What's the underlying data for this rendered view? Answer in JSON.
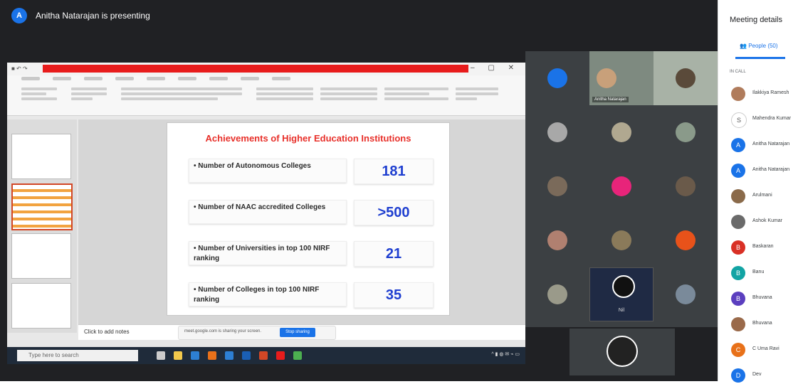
{
  "presenter": {
    "avatar_letter": "A",
    "text": "Anitha Natarajan is presenting"
  },
  "slide": {
    "title": "Achievements of Higher Education Institutions",
    "rows": [
      {
        "label": "• Number of Autonomous Colleges",
        "value": "181"
      },
      {
        "label": "• Number of NAAC accredited Colleges",
        "value": ">500"
      },
      {
        "label": "• Number of Universities in top 100 NIRF ranking",
        "value": "21"
      },
      {
        "label": "• Number of Colleges in top 100 NIRF ranking",
        "value": "35"
      }
    ]
  },
  "notes_placeholder": "Click to add notes",
  "sharing_bar": {
    "message": "meet.google.com is sharing your screen.",
    "stop_label": "Stop sharing"
  },
  "taskbar": {
    "search_placeholder": "Type here to search"
  },
  "tiles": [
    {
      "name": "Anitha Natarajan",
      "letter": "A"
    },
    {
      "name": "Nil",
      "letter": ""
    }
  ],
  "panel": {
    "title": "Meeting details",
    "people_tab": "People (50)",
    "section": "IN CALL",
    "people": [
      {
        "name": "Ilakkiya Ramesh",
        "color": "#b07c5c",
        "letter": ""
      },
      {
        "name": "Mahendra Kumar",
        "color": "#ffffff",
        "letter": "S"
      },
      {
        "name": "Anitha Natarajan",
        "color": "#1a73e8",
        "letter": "A"
      },
      {
        "name": "Anitha Natarajan",
        "color": "#1a73e8",
        "letter": "A"
      },
      {
        "name": "Arulmani",
        "color": "#8a6a4a",
        "letter": ""
      },
      {
        "name": "Ashok Kumar",
        "color": "#6a6a6a",
        "letter": ""
      },
      {
        "name": "Baskaran",
        "color": "#d93025",
        "letter": "B"
      },
      {
        "name": "Banu",
        "color": "#12a4a4",
        "letter": "B"
      },
      {
        "name": "Bhuvana",
        "color": "#5b3fbf",
        "letter": "B"
      },
      {
        "name": "Bhuvana",
        "color": "#9a6a4a",
        "letter": ""
      },
      {
        "name": "C Uma Ravi",
        "color": "#e8711a",
        "letter": "C"
      },
      {
        "name": "Dev",
        "color": "#1a73e8",
        "letter": "D"
      }
    ]
  }
}
